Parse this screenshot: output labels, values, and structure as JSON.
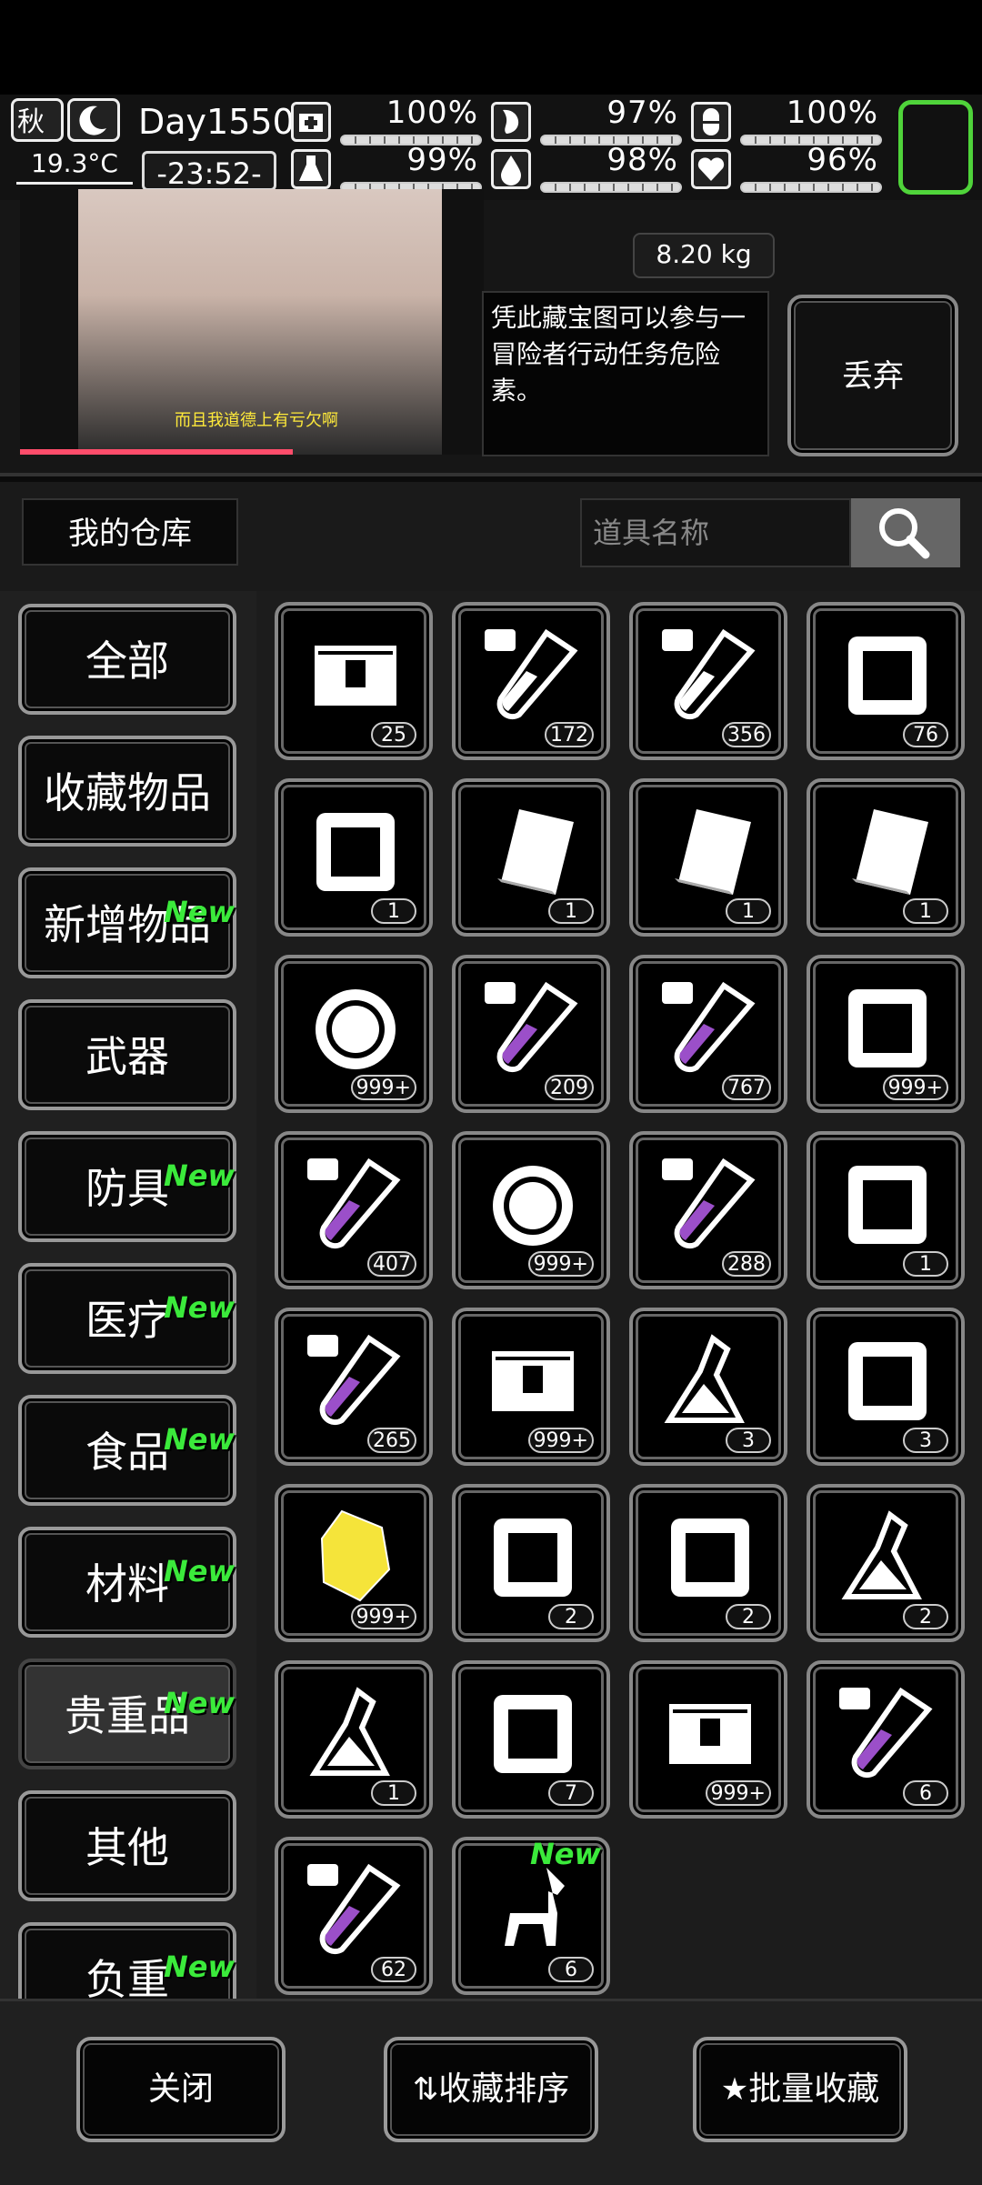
{
  "status": {
    "season": "秋",
    "temperature": "19.3°C",
    "day": "Day1550",
    "time": "-23:52-",
    "stats": [
      {
        "icon": "medkit-icon",
        "percent": "100%"
      },
      {
        "icon": "stomach-icon",
        "percent": "97%"
      },
      {
        "icon": "pill-icon",
        "percent": "100%"
      },
      {
        "icon": "flask-icon",
        "percent": "99%"
      },
      {
        "icon": "water-drop-icon",
        "percent": "98%"
      },
      {
        "icon": "heart-icon",
        "percent": "96%"
      }
    ]
  },
  "item_detail": {
    "weight": "8.20 kg",
    "description": "凭此藏宝图可以参与一\n冒险者行动任务危险\n素。",
    "discard_label": "丢弃",
    "video_caption": "而且我道德上有亏欠啊"
  },
  "warehouse": {
    "title": "我的仓库",
    "search_placeholder": "道具名称"
  },
  "categories": [
    {
      "label": "全部",
      "new": ""
    },
    {
      "label": "收藏物品",
      "new": ""
    },
    {
      "label": "新增物品",
      "new": "New"
    },
    {
      "label": "武器",
      "new": ""
    },
    {
      "label": "防具",
      "new": "New"
    },
    {
      "label": "医疗",
      "new": "New"
    },
    {
      "label": "食品",
      "new": "New"
    },
    {
      "label": "材料",
      "new": "New"
    },
    {
      "label": "贵重品",
      "new": "New"
    },
    {
      "label": "其他",
      "new": ""
    },
    {
      "label": "负重",
      "new": "New"
    }
  ],
  "items": [
    {
      "name": "treasure-chest-icon",
      "count": "25",
      "new": ""
    },
    {
      "name": "test-tube-vii-icon",
      "count": "172",
      "new": ""
    },
    {
      "name": "test-tube-vi-icon",
      "count": "356",
      "new": ""
    },
    {
      "name": "food-bag-icon",
      "count": "76",
      "new": ""
    },
    {
      "name": "toolbox-icon",
      "count": "1",
      "new": ""
    },
    {
      "name": "chinese-book-icon",
      "count": "1",
      "new": ""
    },
    {
      "name": "math-book-icon",
      "count": "1",
      "new": ""
    },
    {
      "name": "english-book-icon",
      "count": "1",
      "new": ""
    },
    {
      "name": "coin-b-icon",
      "count": "999+",
      "new": ""
    },
    {
      "name": "test-tube-gamma-icon",
      "count": "209",
      "new": ""
    },
    {
      "name": "test-tube-delta-icon",
      "count": "767",
      "new": ""
    },
    {
      "name": "monster-card-icon",
      "count": "999+",
      "new": ""
    },
    {
      "name": "test-tube-epsilon-icon",
      "count": "407",
      "new": ""
    },
    {
      "name": "wrench-coin-icon",
      "count": "999+",
      "new": ""
    },
    {
      "name": "test-tube-zeta-icon",
      "count": "288",
      "new": ""
    },
    {
      "name": "robot-badge-icon",
      "count": "1",
      "new": ""
    },
    {
      "name": "test-tube-f-icon",
      "count": "265",
      "new": ""
    },
    {
      "name": "crate-iv-icon",
      "count": "999+",
      "new": ""
    },
    {
      "name": "lab-flask-icon",
      "count": "3",
      "new": ""
    },
    {
      "name": "circuit-board-icon",
      "count": "3",
      "new": ""
    },
    {
      "name": "yellow-crystal-icon",
      "count": "999+",
      "new": ""
    },
    {
      "name": "cpu-chip-icon",
      "count": "2",
      "new": ""
    },
    {
      "name": "drill-icon",
      "count": "2",
      "new": ""
    },
    {
      "name": "flask-ii-icon",
      "count": "2",
      "new": ""
    },
    {
      "name": "flask-i-icon",
      "count": "1",
      "new": ""
    },
    {
      "name": "flower-medal-icon",
      "count": "7",
      "new": ""
    },
    {
      "name": "crate-icon",
      "count": "999+",
      "new": ""
    },
    {
      "name": "test-tube-beta-icon",
      "count": "6",
      "new": ""
    },
    {
      "name": "test-tube-eta-icon",
      "count": "62",
      "new": ""
    },
    {
      "name": "toy-horse-icon",
      "count": "6",
      "new": "New"
    }
  ],
  "footer": {
    "close_label": "关闭",
    "sort_label": "收藏排序",
    "batch_label": "批量收藏"
  }
}
